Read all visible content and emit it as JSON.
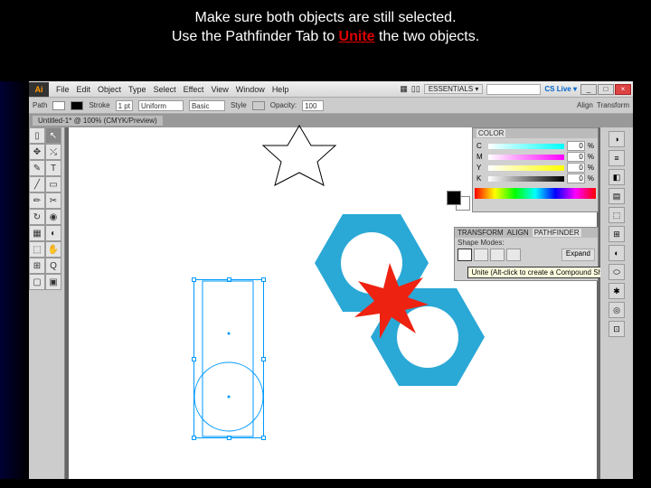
{
  "instruction": {
    "line1": "Make sure both objects are still selected.",
    "line2a": "Use the Pathfinder Tab to ",
    "line2_em": "Unite",
    "line2b": " the two objects."
  },
  "menubar": [
    "File",
    "Edit",
    "Object",
    "Type",
    "Select",
    "Effect",
    "View",
    "Window",
    "Help"
  ],
  "workspace_label": "ESSENTIALS ▾",
  "cslive": "CS Live ▾",
  "winbtns": {
    "min": "_",
    "max": "□",
    "close": "×"
  },
  "controlbar": {
    "mode": "Path",
    "stroke_label": "Stroke",
    "stroke_val": "1 pt",
    "dash_label": "Uniform",
    "brush_label": "Basic",
    "style_label": "Style",
    "opacity_label": "Opacity:",
    "opacity_val": "100",
    "right": [
      "Align",
      "Transform"
    ]
  },
  "document_tab": "Untitled-1* @ 100% (CMYK/Preview)",
  "tools": [
    "▯",
    "↖",
    "✥",
    "⤯",
    "✎",
    "T",
    "╱",
    "▭",
    "✏",
    "✂",
    "↻",
    "◉",
    "▦",
    "◐",
    "⬚",
    "✋",
    "⊞",
    "Q",
    "▢",
    "▣"
  ],
  "color_panel": {
    "tab": "COLOR",
    "channels": [
      {
        "l": "C",
        "v": "0",
        "c": "c"
      },
      {
        "l": "M",
        "v": "0",
        "c": "m"
      },
      {
        "l": "Y",
        "v": "0",
        "c": "y"
      },
      {
        "l": "K",
        "v": "0",
        "c": "k"
      }
    ],
    "pct": "%"
  },
  "pathfinder": {
    "tabs": [
      "TRANSFORM",
      "ALIGN",
      "PATHFINDER"
    ],
    "section": "Shape Modes:",
    "expand": "Expand"
  },
  "tooltip": "Unite (Alt-click to create a Compound Shape a",
  "dock_icons": [
    "◑",
    "≡",
    "◧",
    "▤",
    "⬚",
    "⊞",
    "◐",
    "⬭",
    "✱",
    "◎",
    "⊡"
  ]
}
